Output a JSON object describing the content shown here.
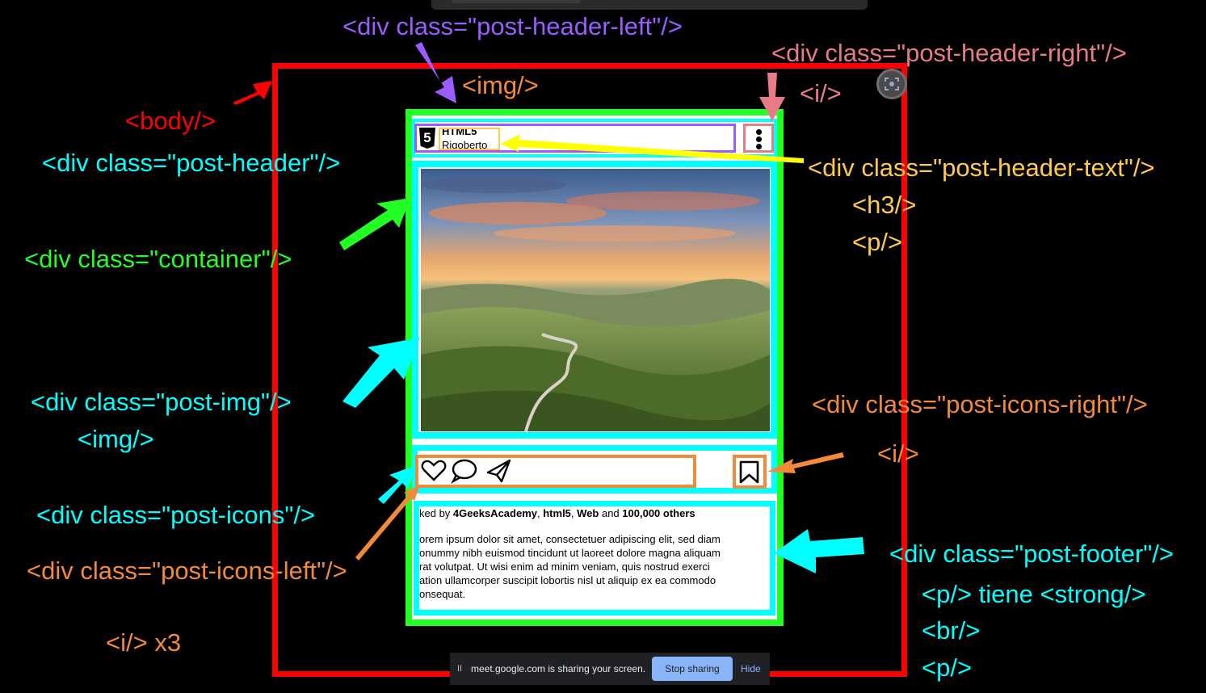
{
  "labels": {
    "post_header_left": "<div class=\"post-header-left\"/>",
    "img_top": "<img/>",
    "post_header_right": "<div class=\"post-header-right\"/>",
    "i_top": "<i/>",
    "body": "<body/>",
    "post_header": "<div class=\"post-header\"/>",
    "post_header_text": "<div class=\"post-header-text\"/>",
    "h3": "<h3/>",
    "p": "<p/>",
    "container": "<div class=\"container\"/>",
    "post_img": "<div class=\"post-img\"/>",
    "img_mid": "<img/>",
    "post_icons_right": "<div class=\"post-icons-right\"/>",
    "i_right": "<i/>",
    "post_icons": "<div class=\"post-icons\"/>",
    "post_icons_left": "<div class=\"post-icons-left\"/>",
    "post_footer": "<div class=\"post-footer\"/>",
    "p_strong": "<p/> tiene <strong/>",
    "br": "<br/>",
    "p_bottom": "<p/>",
    "i_x3": "<i/> x3"
  },
  "post": {
    "title": "HTML5",
    "author": "Rigoberto",
    "logo_glyph": "5",
    "liked_prefix": "ked by ",
    "liked_strong1": "4GeeksAcademy",
    "liked_sep1": ", ",
    "liked_strong2": "html5",
    "liked_sep2": ", ",
    "liked_strong3": "Web",
    "liked_and": " and ",
    "liked_strong4": "100,000 others",
    "body_lines": [
      "orem ipsum dolor sit amet, consectetuer adipiscing elit, sed diam",
      "onummy nibh euismod tincidunt ut laoreet dolore magna aliquam",
      "rat volutpat. Ut wisi enim ad minim veniam, quis nostrud exerci",
      "ation ullamcorper suscipit lobortis nisl ut aliquip ex ea commodo",
      "onsequat."
    ]
  },
  "sharebar": {
    "pause": "II",
    "message": "meet.google.com is sharing your screen.",
    "stop": "Stop sharing",
    "hide": "Hide"
  },
  "colors": {
    "red": "#ff0000",
    "green": "#22ff22",
    "cyan": "#00ffff",
    "purple": "#9b5cff",
    "salmon": "#e87b86",
    "yellow": "#ffc94d",
    "orange": "#f28a3a"
  }
}
